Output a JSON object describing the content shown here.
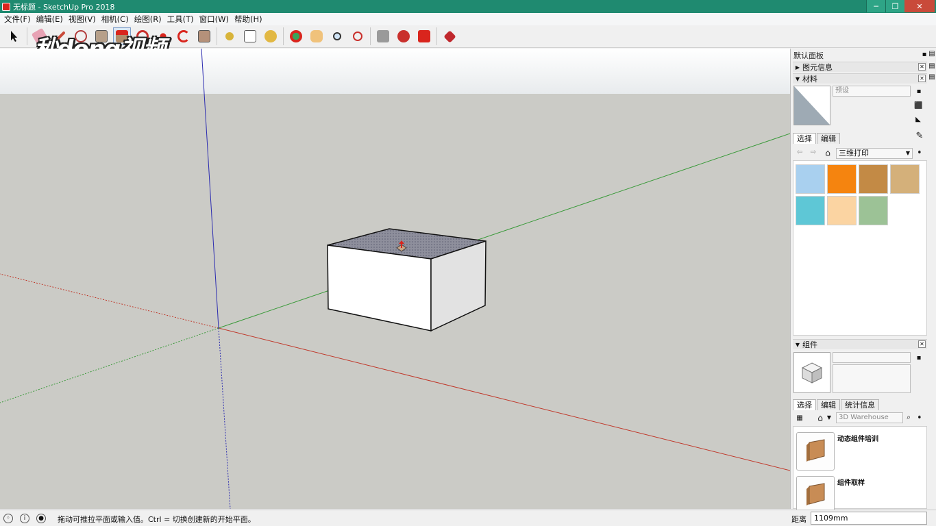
{
  "window": {
    "title": "无标题 - SketchUp Pro 2018",
    "minimize_glyph": "─",
    "maximize_glyph": "❐",
    "close_glyph": "✕"
  },
  "menu": [
    "文件(F)",
    "编辑(E)",
    "视图(V)",
    "相机(C)",
    "绘图(R)",
    "工具(T)",
    "窗口(W)",
    "帮助(H)"
  ],
  "watermark": "秒dong视频",
  "tray": {
    "title": "默认面板",
    "entity_info": {
      "label": "图元信息"
    },
    "materials": {
      "label": "材料",
      "name_field": "预设",
      "tabs": [
        "选择",
        "编辑"
      ],
      "library": "三维打印",
      "swatch_colors": [
        "#a9d0ef",
        "#f5840f",
        "#c38a45",
        "#d4b07a",
        "#5ec7d6",
        "#fbd4a2",
        "#9cc296"
      ]
    },
    "components": {
      "label": "组件",
      "tabs": [
        "选择",
        "编辑",
        "统计信息"
      ],
      "search_placeholder": "3D Warehouse",
      "items": [
        "动态组件培训",
        "组件取样"
      ]
    }
  },
  "status": {
    "message": "拖动可推拉平面或输入值。Ctrl = 切换创建新的开始平面。",
    "distance_label": "距离",
    "distance_value": "1109mm"
  },
  "colors": {
    "titlebar": "#1f8a70",
    "viewport_ground": "#cbcbc6",
    "axis_red": "#c0392b",
    "axis_green": "#3a9a3a",
    "axis_blue": "#2b2bb0"
  }
}
